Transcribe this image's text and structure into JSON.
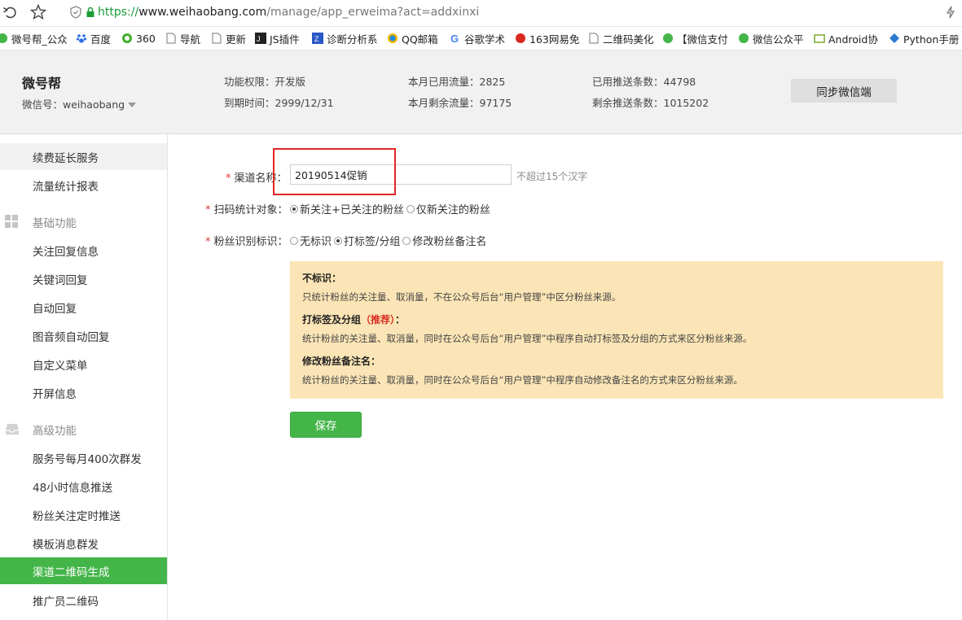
{
  "browser": {
    "url_scheme": "https://",
    "url_host": "www.weihaobang.com",
    "url_path": "/manage/app_erweima?act=addxinxi",
    "bookmarks": [
      "微号帮_公众",
      "百度",
      "360",
      "导航",
      "更新",
      "JS插件",
      "诊断分析系",
      "QQ邮箱",
      "谷歌学术",
      "163网易免",
      "二维码美化",
      "【微信支付",
      "微信公众平",
      "Android协",
      "Python手册"
    ]
  },
  "header": {
    "brand": "微号帮",
    "account_label": "微信号：weihaobang",
    "permission": "功能权限：开发版",
    "expiry": "到期时间：2999/12/31",
    "used_traffic": "本月已用流量：2825",
    "remaining_traffic": "本月剩余流量：97175",
    "used_push": "已用推送条数：44798",
    "remaining_push": "剩余推送条数：1015202",
    "sync_button": "同步微信端"
  },
  "sidebar": {
    "top_items": [
      "续费延长服务",
      "流量统计报表"
    ],
    "basic_section": "基础功能",
    "basic_items": [
      "关注回复信息",
      "关键词回复",
      "自动回复",
      "图音频自动回复",
      "自定义菜单",
      "开屏信息"
    ],
    "advanced_section": "高级功能",
    "advanced_items": [
      "服务号每月400次群发",
      "48小时信息推送",
      "粉丝关注定时推送",
      "模板消息群发",
      "渠道二维码生成",
      "推广员二维码"
    ]
  },
  "form": {
    "channel_label": "渠道名称：",
    "channel_value": "20190514促销",
    "channel_hint": "不超过15个汉字",
    "scan_label": "扫码统计对象：",
    "scan_options": [
      "新关注+已关注的粉丝",
      "仅新关注的粉丝"
    ],
    "scan_selected": 0,
    "identify_label": "粉丝识别标识：",
    "identify_options": [
      "无标识",
      "打标签/分组",
      "修改粉丝备注名"
    ],
    "identify_selected": 1,
    "info": {
      "t1": "不标识：",
      "d1": "只统计粉丝的关注量、取消量，不在公众号后台“用户管理”中区分粉丝来源。",
      "t2": "打标签及分组",
      "t2_rec": "（推荐）",
      "t2_colon": "：",
      "d2": "统计粉丝的关注量、取消量，同时在公众号后台“用户管理”中程序自动打标签及分组的方式来区分粉丝来源。",
      "t3": "修改粉丝备注名：",
      "d3": "统计粉丝的关注量、取消量，同时在公众号后台“用户管理”中程序自动修改备注名的方式来区分粉丝来源。"
    },
    "save_button": "保存"
  },
  "colors": {
    "accent_green": "#44b549",
    "info_bg": "#fbe5b6",
    "required_red": "#e4393c",
    "annotation_red": "#e02525"
  }
}
